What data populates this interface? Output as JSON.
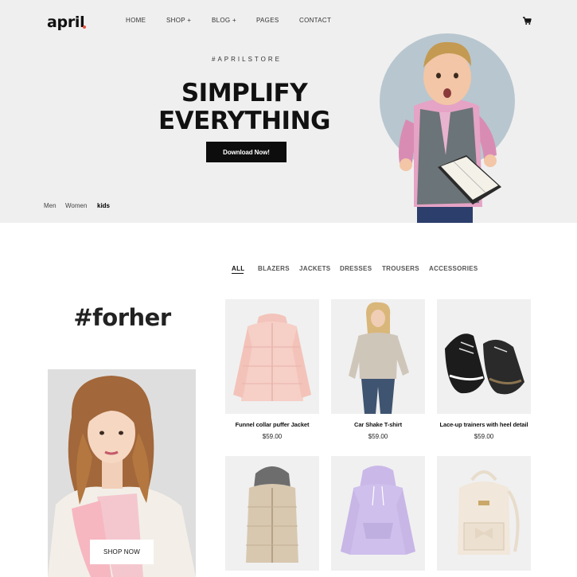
{
  "brand": {
    "name": "april",
    "accent_color": "#e8523f"
  },
  "nav": {
    "items": [
      "HOME",
      "SHOP +",
      "BLOG +",
      "PAGES",
      "CONTACT"
    ],
    "cart_icon": "cart-icon"
  },
  "hero": {
    "hashtag": "#APRILSTORE",
    "headline_line1": "SIMPLIFY",
    "headline_line2": "EVERYTHING",
    "cta_label": "Download Now!",
    "tabs": [
      "Men",
      "Women",
      "kids"
    ],
    "active_tab": "kids"
  },
  "filters": {
    "items": [
      "ALL",
      "BLAZERS",
      "JACKETS",
      "DRESSES",
      "TROUSERS",
      "ACCESSORIES"
    ],
    "active": "ALL"
  },
  "promo": {
    "heading": "#forher",
    "button_label": "SHOP NOW"
  },
  "products": [
    {
      "name": "Funnel collar puffer Jacket",
      "price": "$59.00"
    },
    {
      "name": "Car Shake T-shirt",
      "price": "$59.00"
    },
    {
      "name": "Lace-up trainers with heel detail",
      "price": "$59.00"
    },
    {
      "name": "",
      "price": ""
    },
    {
      "name": "",
      "price": ""
    },
    {
      "name": "",
      "price": ""
    }
  ]
}
